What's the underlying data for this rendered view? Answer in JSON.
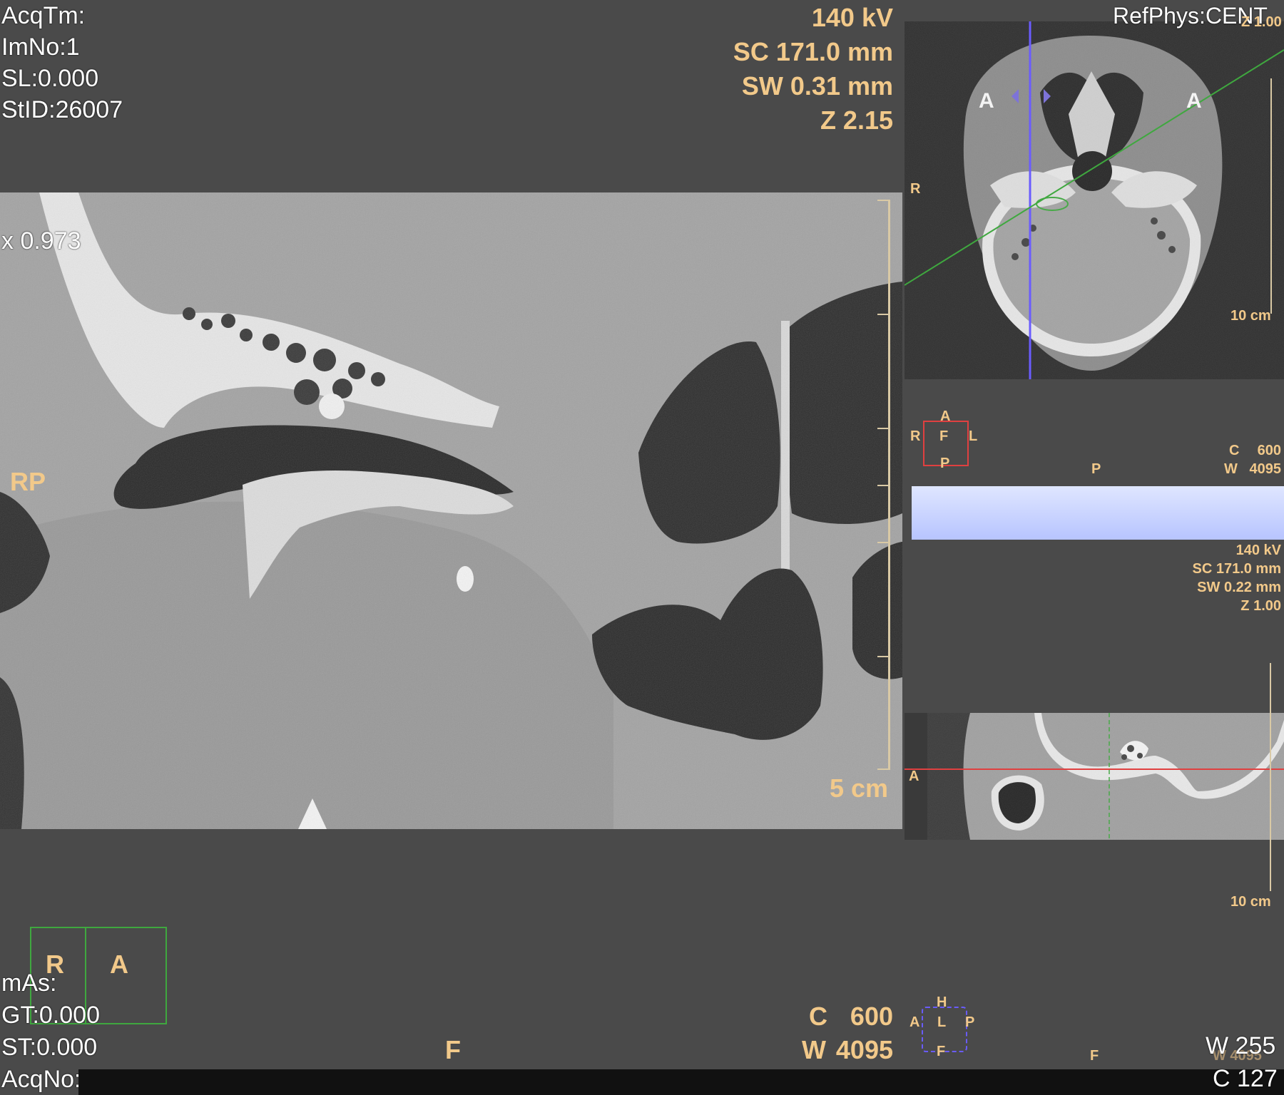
{
  "main_view": {
    "top_left": [
      "AcqTm:",
      "ImNo:1",
      "SL:0.000",
      "StID:26007"
    ],
    "top_right": [
      "140 kV",
      "SC 171.0 mm",
      "SW 0.31 mm",
      "Z 2.15"
    ],
    "zoom_label": "x 0.973",
    "orientation_left": "RP",
    "scale_label": "5 cm",
    "bottom_left": [
      "mAs:",
      "GT:0.000",
      "ST:0.000",
      "AcqNo:"
    ],
    "orientation_bottom": "F",
    "window_center_label": "C",
    "window_center_value": "600",
    "window_width_label": "W",
    "window_width_value": "4095",
    "orientation_cube": {
      "left": "R",
      "right": "A"
    }
  },
  "axial_view": {
    "ref_phys": "RefPhys:CENT",
    "corner_top": "Z 1.00",
    "orientation_left": "R",
    "marker_left": "A",
    "marker_right": "A",
    "scale_label": "10 cm"
  },
  "middle_view": {
    "orient_top": "A",
    "orient_left": "R",
    "orient_center": "F",
    "orient_right": "L",
    "orient_bottom": "P",
    "label_p": "P",
    "c_label": "C",
    "c_value": "600",
    "w_label": "W",
    "w_value": "4095",
    "info": [
      "140 kV",
      "SC 171.0 mm",
      "SW 0.22 mm",
      "Z 1.00"
    ]
  },
  "sagittal_view": {
    "orientation_left": "A",
    "scale_label": "10 cm",
    "orient_top": "H",
    "orient_left": "A",
    "orient_center": "L",
    "orient_right": "P",
    "orient_bottom": "F",
    "label_f": "F",
    "window_width": "W 255",
    "window_center": "C 127",
    "faint_w": "W 4095"
  },
  "colors": {
    "background": "#4a4a4a",
    "overlay_text": "#f2c98a",
    "crosshair_blue": "#6a5cff",
    "crosshair_green": "#3fa83f",
    "crosshair_red": "#e04040",
    "bar_blue": "#c9d4ff"
  }
}
